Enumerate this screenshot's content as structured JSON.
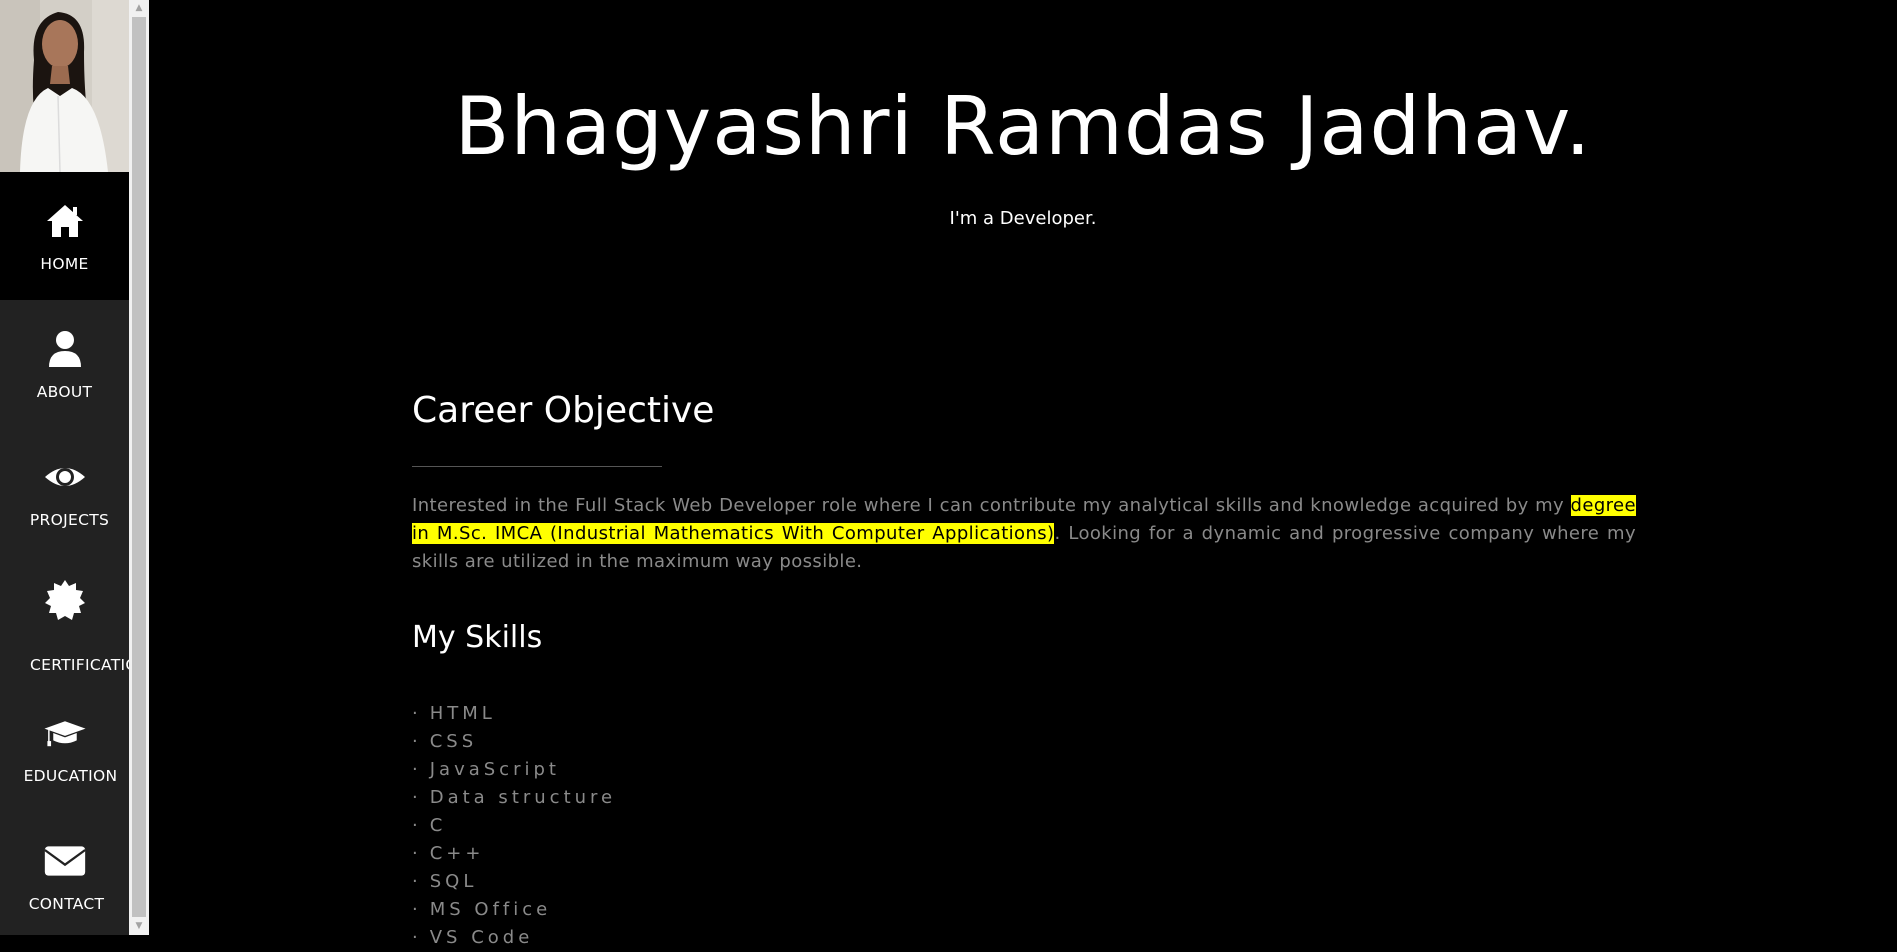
{
  "sidebar": {
    "items": [
      {
        "label": "HOME",
        "icon": "home-icon"
      },
      {
        "label": "ABOUT",
        "icon": "user-icon"
      },
      {
        "label": "PROJECTS",
        "icon": "eye-icon"
      },
      {
        "label": "CERTIFICATIONS",
        "icon": "certificate-icon"
      },
      {
        "label": "EDUCATION",
        "icon": "graduation-cap-icon"
      },
      {
        "label": "CONTACT",
        "icon": "envelope-icon"
      }
    ],
    "active": "HOME"
  },
  "hero": {
    "name": "Bhagyashri Ramdas Jadhav.",
    "tagline": "I'm a Developer."
  },
  "career": {
    "heading": "Career Objective",
    "text_before": "Interested in the Full Stack Web Developer role where I can contribute my analytical skills and knowledge acquired by my ",
    "highlight": "degree in M.Sc. IMCA (Industrial Mathematics With Computer Applications)",
    "text_after": ". Looking for a dynamic and progressive company where my skills are utilized in the maximum way possible."
  },
  "skills": {
    "heading": "My Skills",
    "bullet": "·",
    "items": [
      "HTML",
      "CSS",
      "JavaScript",
      "Data structure",
      "C",
      "C++",
      "SQL",
      "MS Office",
      "VS Code"
    ]
  },
  "colors": {
    "background": "#000000",
    "sidebar": "#222222",
    "highlight": "#ffff00",
    "muted_text": "#8a8a8a"
  }
}
